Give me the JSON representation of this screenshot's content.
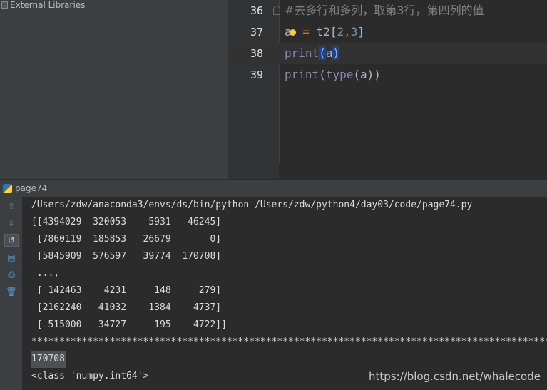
{
  "project": {
    "external_libraries_label": "External Libraries"
  },
  "editor": {
    "lines": [
      {
        "number": "36",
        "parts": [
          {
            "t": "#去多行和多列，取第3行，第四列的值",
            "c": "cmt"
          }
        ]
      },
      {
        "number": "37",
        "parts": [
          {
            "t": "a",
            "c": ""
          },
          {
            "t": "",
            "c": "bulb"
          },
          {
            "t": " = ",
            "c": "op"
          },
          {
            "t": "t2[",
            "c": ""
          },
          {
            "t": "2",
            "c": "num"
          },
          {
            "t": ",",
            "c": "op"
          },
          {
            "t": "3",
            "c": "num"
          },
          {
            "t": "]",
            "c": ""
          }
        ]
      },
      {
        "number": "38",
        "current": true,
        "parts": [
          {
            "t": "print",
            "c": "kw"
          },
          {
            "t": "(",
            "c": "hl"
          },
          {
            "t": "a",
            "c": ""
          },
          {
            "t": ")",
            "c": "hl"
          }
        ]
      },
      {
        "number": "39",
        "parts": [
          {
            "t": "print",
            "c": "kw"
          },
          {
            "t": "(",
            "c": ""
          },
          {
            "t": "type",
            "c": "kw"
          },
          {
            "t": "(a))",
            "c": ""
          }
        ]
      }
    ]
  },
  "run": {
    "tab_title": "page74",
    "output_lines": [
      "/Users/zdw/anaconda3/envs/ds/bin/python /Users/zdw/python4/day03/code/page74.py",
      "[[4394029  320053    5931   46245]",
      " [7860119  185853   26679       0]",
      " [5845909  576597   39774  170708]",
      " ...,",
      " [ 142463    4231     148     279]",
      " [2162240   41032    1384    4737]",
      " [ 515000   34727     195    4722]]",
      "****************************************************************************************************",
      "170708",
      "<class 'numpy.int64'>"
    ],
    "selected_output_index": 9
  },
  "watermark": "https://blog.csdn.net/whalecode"
}
